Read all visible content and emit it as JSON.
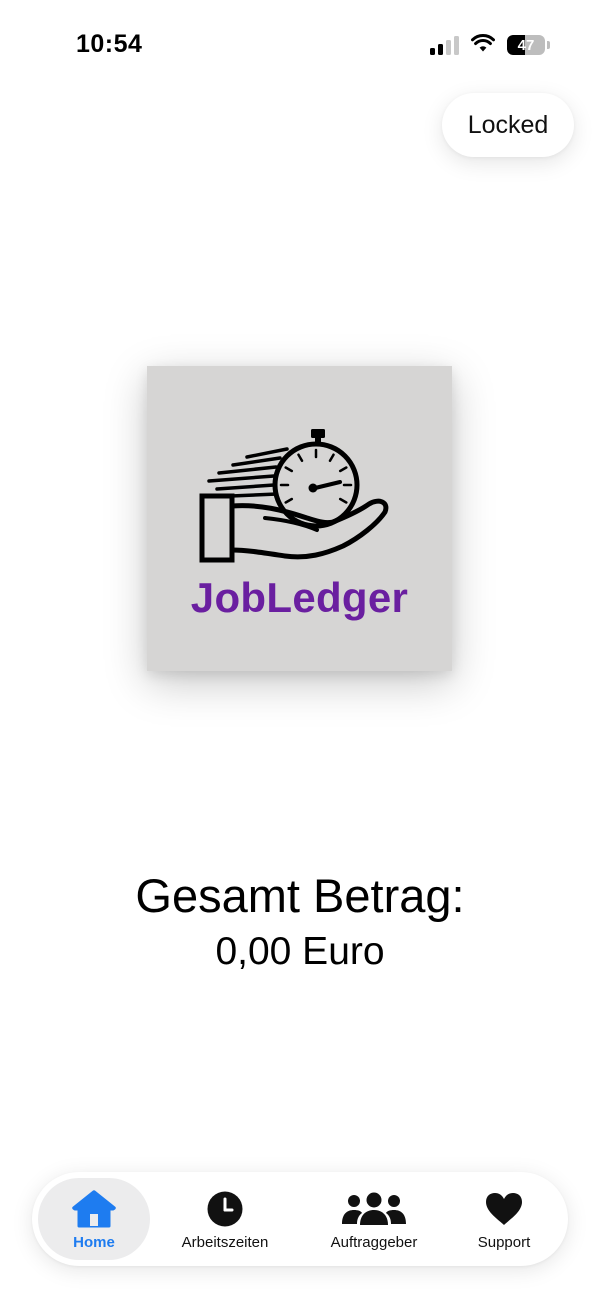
{
  "status_bar": {
    "time": "10:54",
    "battery_level": "47",
    "battery_fraction": 0.47,
    "signal_icon": "cellular-signal-icon",
    "wifi_icon": "wifi-icon"
  },
  "lock_button": {
    "label": "Locked"
  },
  "logo": {
    "text": "JobLedger",
    "icon": "hand-stopwatch-logo",
    "text_color": "#6a1fa0",
    "background_color": "#d6d5d4"
  },
  "summary": {
    "label": "Gesamt Betrag:",
    "value": "0,00 Euro"
  },
  "tab_bar": {
    "active_color": "#1e7cf0",
    "tabs": [
      {
        "label": "Home",
        "icon": "house-icon",
        "active": true
      },
      {
        "label": "Arbeitszeiten",
        "icon": "clock-icon",
        "active": false
      },
      {
        "label": "Auftraggeber",
        "icon": "people-icon",
        "active": false
      },
      {
        "label": "Support",
        "icon": "heart-icon",
        "active": false
      }
    ]
  }
}
